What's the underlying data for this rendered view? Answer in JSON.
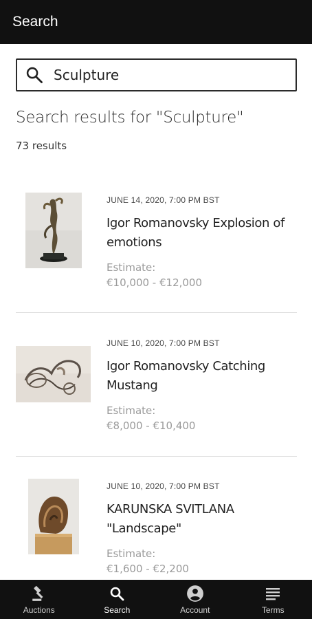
{
  "header": {
    "title": "Search"
  },
  "search": {
    "value": "Sculpture",
    "placeholder": ""
  },
  "results": {
    "title": "Search results for \"Sculpture\"",
    "count": "73 results"
  },
  "items": [
    {
      "date": "JUNE 14, 2020, 7:00 PM BST",
      "name": " Igor Romanovsky Explosion of emotions",
      "estimate_label": "Estimate:",
      "estimate_value": "€10,000 - €12,000"
    },
    {
      "date": "JUNE 10, 2020, 7:00 PM BST",
      "name": " Igor Romanovsky Catching Mustang",
      "estimate_label": "Estimate:",
      "estimate_value": "€8,000 - €10,400"
    },
    {
      "date": "JUNE 10, 2020, 7:00 PM BST",
      "name": "KARUNSKA SVITLANA \"Landscape\"",
      "estimate_label": "Estimate:",
      "estimate_value": "€1,600 - €2,200"
    }
  ],
  "nav": {
    "items": [
      {
        "label": "Auctions",
        "icon": "gavel-icon"
      },
      {
        "label": "Search",
        "icon": "search-icon"
      },
      {
        "label": "Account",
        "icon": "account-icon"
      },
      {
        "label": "Terms",
        "icon": "terms-icon"
      }
    ],
    "active": "Search"
  },
  "colors": {
    "bar": "#111111",
    "muted": "#9a9a9a"
  }
}
